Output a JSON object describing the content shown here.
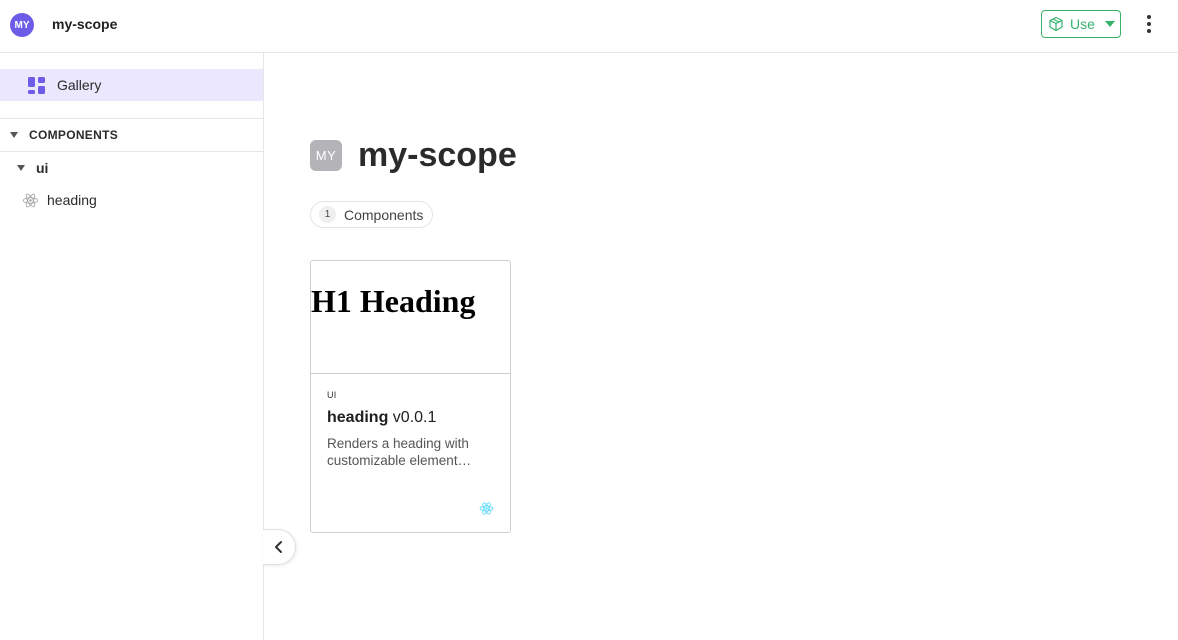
{
  "topbar": {
    "scope_avatar": "MY",
    "scope_name": "my-scope",
    "use_label": "Use"
  },
  "sidebar": {
    "gallery_label": "Gallery",
    "section_label": "COMPONENTS",
    "namespace": "ui",
    "component": "heading"
  },
  "main": {
    "avatar": "MY",
    "title": "my-scope",
    "count": "1",
    "count_label": "Components"
  },
  "card": {
    "preview_text": "H1 Heading",
    "namespace": "UI",
    "name": "heading",
    "version": "v0.0.1",
    "description": "Renders a heading with customizable element…"
  },
  "colors": {
    "accent": "#6c5ce7",
    "use_green": "#37b26c",
    "react_blue": "#61dafb",
    "gallery_bg": "#ebe7fc"
  }
}
